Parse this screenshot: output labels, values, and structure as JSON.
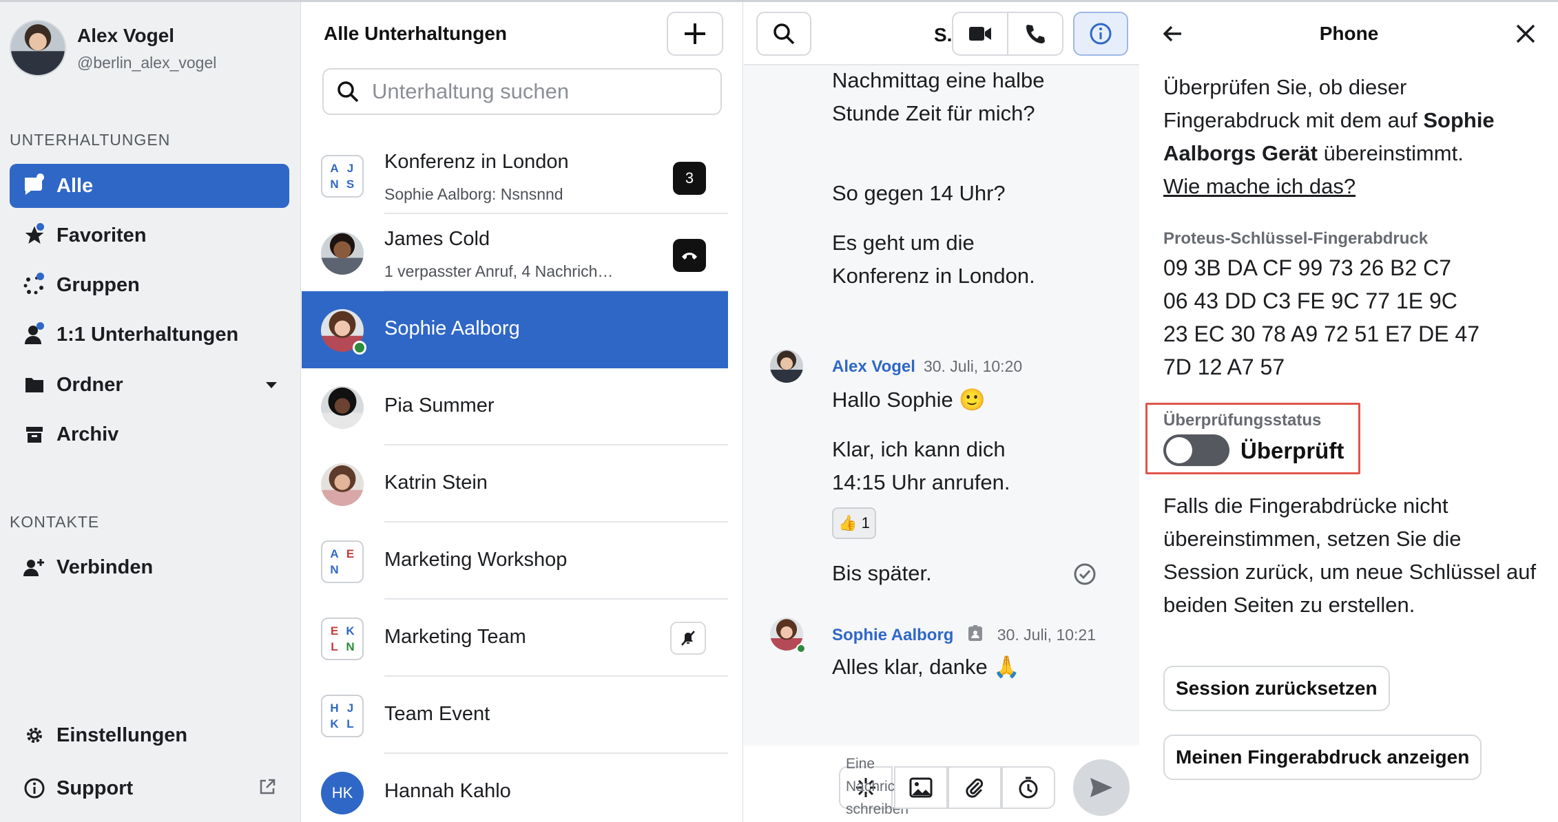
{
  "profile": {
    "name": "Alex Vogel",
    "handle": "@berlin_alex_vogel"
  },
  "sidebar": {
    "section_conversations": "UNTERHALTUNGEN",
    "items": [
      {
        "label": "Alle",
        "icon": "chat-bubble-icon"
      },
      {
        "label": "Favoriten",
        "icon": "star-icon"
      },
      {
        "label": "Gruppen",
        "icon": "groups-icon"
      },
      {
        "label": "1:1 Unterhaltungen",
        "icon": "person-icon"
      },
      {
        "label": "Ordner",
        "icon": "folder-icon"
      },
      {
        "label": "Archiv",
        "icon": "archive-icon"
      }
    ],
    "section_contacts": "KONTAKTE",
    "connect": "Verbinden",
    "settings": "Einstellungen",
    "support": "Support"
  },
  "list": {
    "title": "Alle Unterhaltungen",
    "search_placeholder": "Unterhaltung suchen",
    "rows": [
      {
        "title": "Konferenz in London",
        "subtitle": "Sophie Aalborg: Nsnsnnd",
        "badge": "3",
        "initials": [
          "A",
          "J",
          "N",
          "S"
        ]
      },
      {
        "title": "James Cold",
        "subtitle": "1 verpasster Anruf, 4 Nachrich…"
      },
      {
        "title": "Sophie Aalborg"
      },
      {
        "title": "Pia Summer"
      },
      {
        "title": "Katrin Stein"
      },
      {
        "title": "Marketing Workshop",
        "initials": [
          "A",
          "E",
          "N",
          ""
        ]
      },
      {
        "title": "Marketing Team",
        "initials": [
          "E",
          "K",
          "L",
          "N"
        ]
      },
      {
        "title": "Team Event",
        "initials": [
          "H",
          "J",
          "K",
          "L"
        ]
      },
      {
        "title": "Hannah Kahlo",
        "initials_single": "HK"
      }
    ]
  },
  "conversation": {
    "name": "S.",
    "messages_top": [
      "Nachmittag eine halbe Stunde Zeit für mich?",
      "So gegen 14 Uhr?",
      "Es geht um die Konferenz in London."
    ],
    "msg1": {
      "sender": "Alex Vogel",
      "time": "30. Juli, 10:20",
      "lines": [
        "Hallo Sophie 🙂",
        "Klar, ich kann dich 14:15 Uhr anrufen."
      ],
      "reaction": "👍 1",
      "last": "Bis später."
    },
    "msg2": {
      "sender": "Sophie Aalborg",
      "time": "30. Juli, 10:21",
      "text": "Alles klar, danke 🙏"
    },
    "composer_placeholder": "Eine Nachricht schreiben"
  },
  "panel": {
    "title": "Phone",
    "intro_a": "Überprüfen Sie, ob dieser Fingerabdruck mit dem auf ",
    "intro_b": "Sophie Aalborgs Gerät",
    "intro_c": " übereinstimmt.",
    "how": "Wie mache ich das?",
    "fp_label": "Proteus-Schlüssel-Fingerabdruck",
    "fp_lines": [
      "09 3B DA CF 99 73 26 B2 C7",
      "06 43 DD C3 FE 9C 77 1E 9C",
      "23 EC 30 78 A9 72 51 E7 DE 47",
      "7D 12 A7 57"
    ],
    "status_label": "Überprüfungsstatus",
    "status_value": "Überprüft",
    "note": "Falls die Fingerabdrücke nicht übereinstimmen, setzen Sie die Session zurück, um neue Schlüssel auf beiden Seiten zu erstellen.",
    "reset_button": "Session zurücksetzen",
    "show_button": "Meinen Fingerabdruck anzeigen"
  },
  "colors": {
    "accent": "#2f67c7",
    "online": "#2e8a3c",
    "highlight": "#e0554a"
  }
}
